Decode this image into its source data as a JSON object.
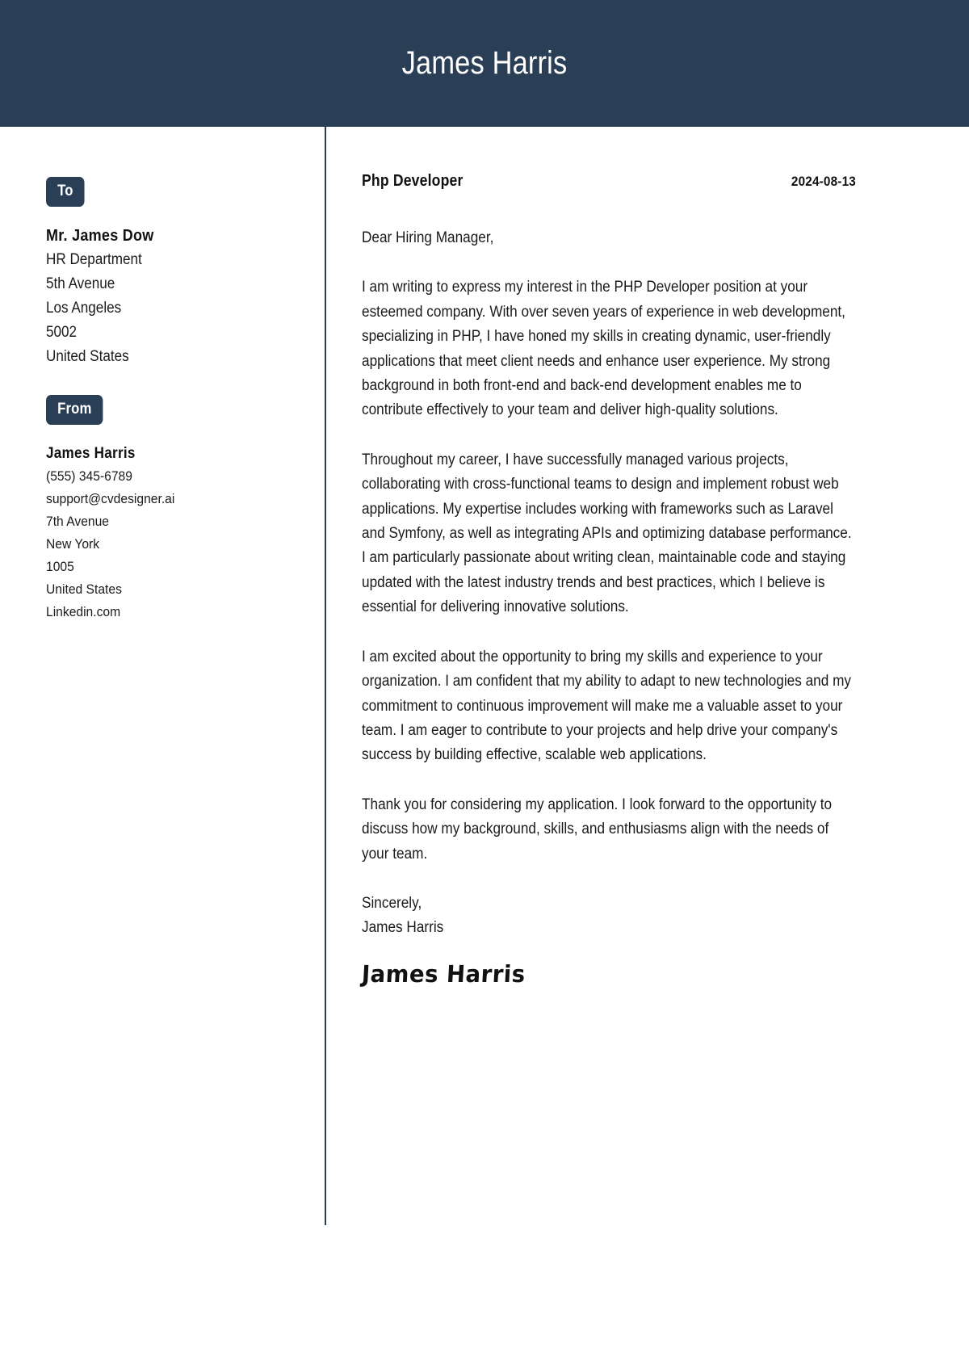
{
  "header": {
    "name": "James Harris",
    "background_color": "#2a3f55"
  },
  "sidebar": {
    "to": {
      "badge_label": "To",
      "name": "Mr. James Dow",
      "lines": [
        "HR Department",
        "5th Avenue",
        "Los Angeles",
        "5002",
        "United States"
      ]
    },
    "from": {
      "badge_label": "From",
      "name": "James Harris",
      "lines": [
        "(555) 345-6789",
        "support@cvdesigner.ai",
        "7th Avenue",
        "New York",
        "1005",
        "United States",
        "Linkedin.com"
      ]
    }
  },
  "letter": {
    "job_title": "Php Developer",
    "date": "2024-08-13",
    "salutation": "Dear Hiring Manager,",
    "paragraphs": [
      "I am writing to express my interest in the PHP Developer position at your esteemed company. With over seven years of experience in web development, specializing in PHP, I have honed my skills in creating dynamic, user-friendly applications that meet client needs and enhance user experience. My strong background in both front-end and back-end development enables me to contribute effectively to your team and deliver high-quality solutions.",
      "Throughout my career, I have successfully managed various projects, collaborating with cross-functional teams to design and implement robust web applications. My expertise includes working with frameworks such as Laravel and Symfony, as well as integrating APIs and optimizing database performance. I am particularly passionate about writing clean, maintainable code and staying updated with the latest industry trends and best practices, which I believe is essential for delivering innovative solutions.",
      "I am excited about the opportunity to bring my skills and experience to your organization. I am confident that my ability to adapt to new technologies and my commitment to continuous improvement will make me a valuable asset to your team. I am eager to contribute to your projects and help drive your company's success by building effective, scalable web applications.",
      "Thank you for considering my application. I look forward to the opportunity to discuss how my background, skills, and enthusiasms align with the needs of your team."
    ],
    "closing_salutation": "Sincerely,",
    "closing_name": "James Harris",
    "signature": "James Harris"
  }
}
